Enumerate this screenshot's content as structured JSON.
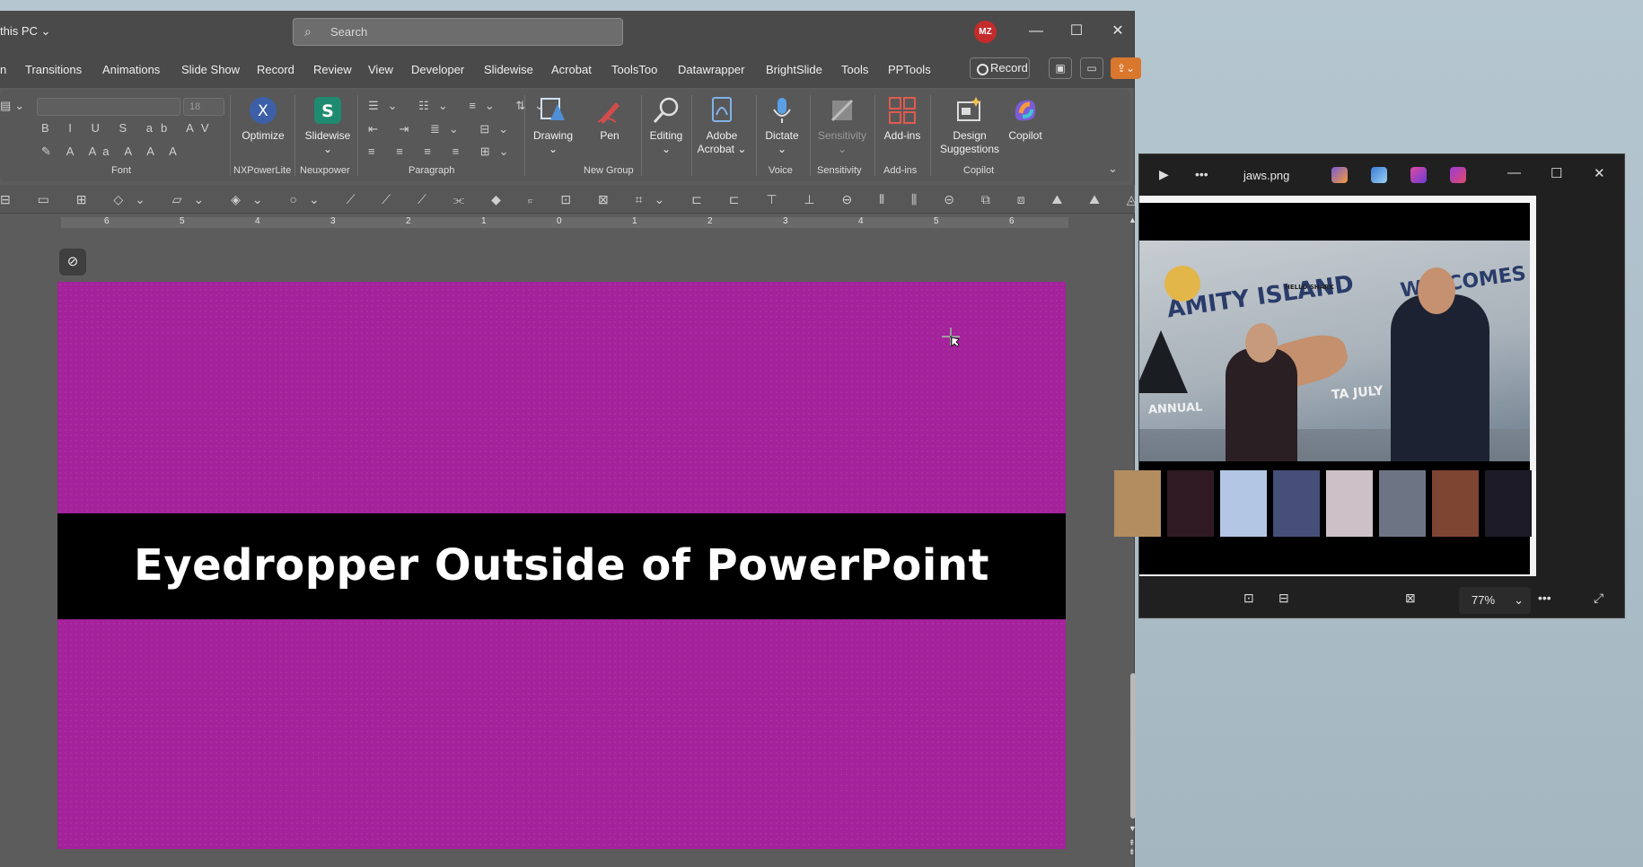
{
  "ppt": {
    "location": "this PC",
    "search_placeholder": "Search",
    "avatar_initials": "MZ",
    "tabs": [
      "n",
      "Transitions",
      "Animations",
      "Slide Show",
      "Record",
      "Review",
      "View",
      "Developer",
      "Slidewise",
      "Acrobat",
      "ToolsToo",
      "Datawrapper",
      "BrightSlide",
      "Tools",
      "PPTools"
    ],
    "record_button": "Record",
    "font_size": "18",
    "ribbon_buttons": {
      "optimize": "Optimize",
      "slidewise": "Slidewise",
      "drawing": "Drawing",
      "pen": "Pen",
      "editing": "Editing",
      "adobe_acrobat": "Adobe Acrobat",
      "dictate": "Dictate",
      "sensitivity": "Sensitivity",
      "addins": "Add-ins",
      "design_suggestions": "Design Suggestions",
      "copilot": "Copilot"
    },
    "groups": [
      "Font",
      "NXPowerLite",
      "Neuxpower",
      "Paragraph",
      "New Group",
      "Voice",
      "Sensitivity",
      "Add-ins",
      "Copilot"
    ],
    "ruler_numbers": [
      "6",
      "5",
      "4",
      "3",
      "2",
      "1",
      "0",
      "1",
      "2",
      "3",
      "4",
      "5",
      "6"
    ],
    "slide_title": "Eyedropper Outside of PowerPoint",
    "slide_bg": "#a4229b"
  },
  "viewer": {
    "filename": "jaws.png",
    "zoom": "77%",
    "billboard": {
      "line1": "AMITY ISLAND",
      "line2": "WELCOMES YOU",
      "annual": "ANNUAL",
      "july": "TA JULY",
      "bubble": "HELLO SHARK"
    },
    "swatch_colors": [
      "#b28d5f",
      "#2f1a23",
      "#b2c6e4",
      "#464f78",
      "#cdc0c6",
      "#6d7585",
      "#7f4533",
      "#1e1b28"
    ]
  }
}
